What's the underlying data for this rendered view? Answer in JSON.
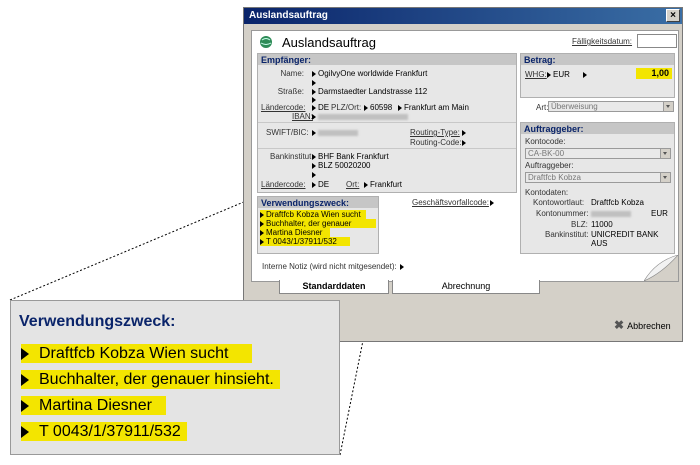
{
  "window": {
    "title": "Auslandsauftrag",
    "close_glyph": "×",
    "header_title": "Auslandsauftrag",
    "faelligkeit_label": "Fälligkeitsdatum:"
  },
  "empfaenger": {
    "header": "Empfänger:",
    "name_label": "Name:",
    "name_value": "OgilvyOne worldwide Frankfurt",
    "strasse_label": "Straße:",
    "strasse_value": "Darmstaedter Landstrasse 112",
    "laendercode_label": "Ländercode:",
    "laendercode_value": "DE",
    "plz_ort_label": "PLZ/Ort:",
    "plz_value": "60598",
    "ort_value": "Frankfurt am Main",
    "iban_label": "IBAN:",
    "swift_label": "SWIFT/BIC:",
    "routing_type_label": "Routing-Type:",
    "routing_code_label": "Routing-Code:",
    "bankinstitut_label": "Bankinstitut:",
    "bank_value": "BHF Bank Frankfurt",
    "blz_value": "BLZ 50020200",
    "laendercode2_label": "Ländercode:",
    "laendercode2_value": "DE",
    "ort_label": "Ort:",
    "ort2_value": "Frankfurt"
  },
  "verwendung": {
    "header": "Verwendungszweck:",
    "lines": [
      "Draftfcb Kobza Wien sucht",
      "Buchhalter, der genauer hinsieht.",
      "Martina Diesner",
      "T 0043/1/37911/532"
    ],
    "geschaeft_label": "Geschäftsvorfallcode:"
  },
  "betrag": {
    "header": "Betrag:",
    "whg_label": "WHG:",
    "currency": "EUR",
    "amount": "1,00",
    "art_label": "Art:",
    "art_value": "Überweisung"
  },
  "auftraggeber": {
    "header": "Auftraggeber:",
    "kontocode_label": "Kontocode:",
    "kontocode_value": "CA-BK-00",
    "auftraggeber_label": "Auftraggeber:",
    "auftraggeber_value": "Draftfcb Kobza",
    "kontodaten_label": "Kontodaten:",
    "wortlaut_label": "Kontowortlaut:",
    "wortlaut_value": "Draftfcb Kobza",
    "kontonummer_label": "Kontonummer:",
    "kontonummer_currency": "EUR",
    "blz_label": "BLZ:",
    "blz_value": "11000",
    "bankinstitut_label": "Bankinstitut:",
    "bankinstitut_value": "UNICREDIT BANK AUS"
  },
  "notiz_label": "Interne Notiz (wird nicht mitgesendet):",
  "tabs": {
    "standard": "Standarddaten",
    "abrechnung": "Abrechnung"
  },
  "abbrechen_label": "Abbrechen",
  "zoom": {
    "header": "Verwendungszweck:",
    "lines": [
      "Draftfcb Kobza Wien sucht",
      "Buchhalter, der genauer hinsieht.",
      "Martina Diesner",
      "T 0043/1/37911/532"
    ]
  },
  "colors": {
    "highlight": "#f3e500",
    "header_blue": "#0a246a"
  }
}
